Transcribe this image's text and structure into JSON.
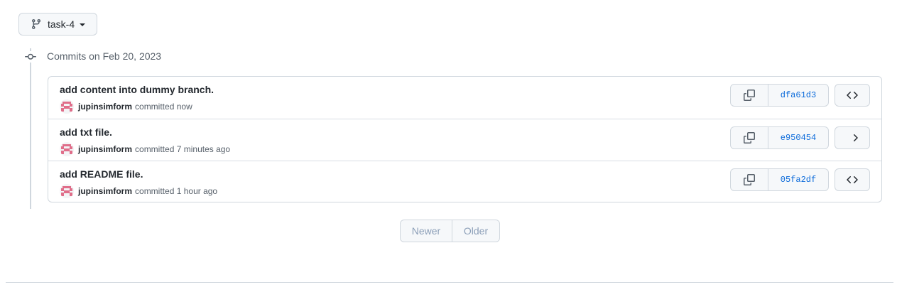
{
  "branch": {
    "name": "task-4"
  },
  "group": {
    "title": "Commits on Feb 20, 2023"
  },
  "commits": [
    {
      "message": "add content into dummy branch.",
      "author": "jupinsimform",
      "verb": "committed",
      "time": "now",
      "sha": "dfa61d3"
    },
    {
      "message": "add txt file.",
      "author": "jupinsimform",
      "verb": "committed",
      "time": "7 minutes ago",
      "sha": "e950454"
    },
    {
      "message": "add README file.",
      "author": "jupinsimform",
      "verb": "committed",
      "time": "1 hour ago",
      "sha": "05fa2df"
    }
  ],
  "pagination": {
    "newer": "Newer",
    "older": "Older"
  },
  "icons": {
    "branch": "git-branch-icon",
    "commit": "git-commit-icon",
    "copy": "copy-icon",
    "browse": "code-icon"
  },
  "colors": {
    "link": "#0969da",
    "border": "#d0d7de",
    "avatar": "#e06e8a"
  }
}
